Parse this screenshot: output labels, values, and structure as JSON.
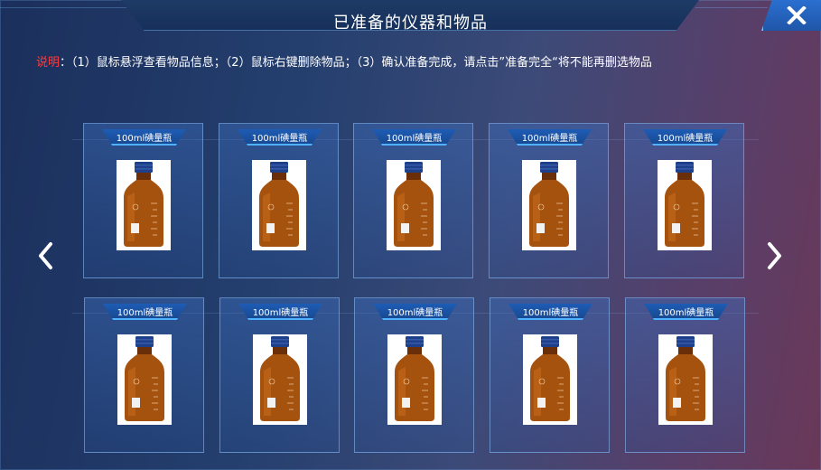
{
  "window": {
    "title": "已准备的仪器和物品",
    "close_icon": "close-icon"
  },
  "instructions": {
    "label": "说明",
    "separator": "：",
    "text": "（1）鼠标悬浮查看物品信息；（2）鼠标右键删除物品；（3）确认准备完成，请点击”准备完全“将不能再删选物品"
  },
  "navigation": {
    "prev_icon": "chevron-left-icon",
    "next_icon": "chevron-right-icon"
  },
  "items": [
    {
      "label": "100ml碘量瓶",
      "icon": "amber-reagent-bottle-image"
    },
    {
      "label": "100ml碘量瓶",
      "icon": "amber-reagent-bottle-image"
    },
    {
      "label": "100ml碘量瓶",
      "icon": "amber-reagent-bottle-image"
    },
    {
      "label": "100ml碘量瓶",
      "icon": "amber-reagent-bottle-image"
    },
    {
      "label": "100ml碘量瓶",
      "icon": "amber-reagent-bottle-image"
    },
    {
      "label": "100ml碘量瓶",
      "icon": "amber-reagent-bottle-image"
    },
    {
      "label": "100ml碘量瓶",
      "icon": "amber-reagent-bottle-image"
    },
    {
      "label": "100ml碘量瓶",
      "icon": "amber-reagent-bottle-image"
    },
    {
      "label": "100ml碘量瓶",
      "icon": "amber-reagent-bottle-image"
    },
    {
      "label": "100ml碘量瓶",
      "icon": "amber-reagent-bottle-image"
    }
  ],
  "colors": {
    "instruction_label": "#ff3b3b",
    "accent": "#4fb1ff",
    "close_button": "#2b6fd0"
  }
}
